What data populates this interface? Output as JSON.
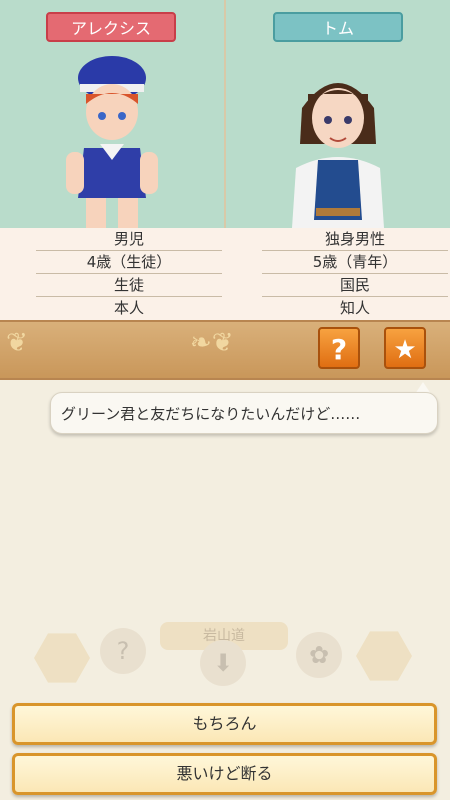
{
  "characters": {
    "left": {
      "name": "アレクシス",
      "info": [
        "男児",
        "4歳（生徒）",
        "生徒",
        "本人"
      ]
    },
    "right": {
      "name": "トム",
      "info": [
        "独身男性",
        "5歳（青年）",
        "国民",
        "知人"
      ]
    }
  },
  "toolbar": {
    "help_label": "?",
    "favorite_label": "★"
  },
  "dialogue": {
    "text": "グリーン君と友だちになりたいんだけど……"
  },
  "background_hud": {
    "road_sign": "岩山道"
  },
  "choices": [
    {
      "label": "もちろん"
    },
    {
      "label": "悪いけど断る"
    }
  ],
  "colors": {
    "left_tag": "#e46a72",
    "right_tag": "#7cc2c4",
    "orange_button": "#f08a2a",
    "choice_border": "#d9952b"
  }
}
